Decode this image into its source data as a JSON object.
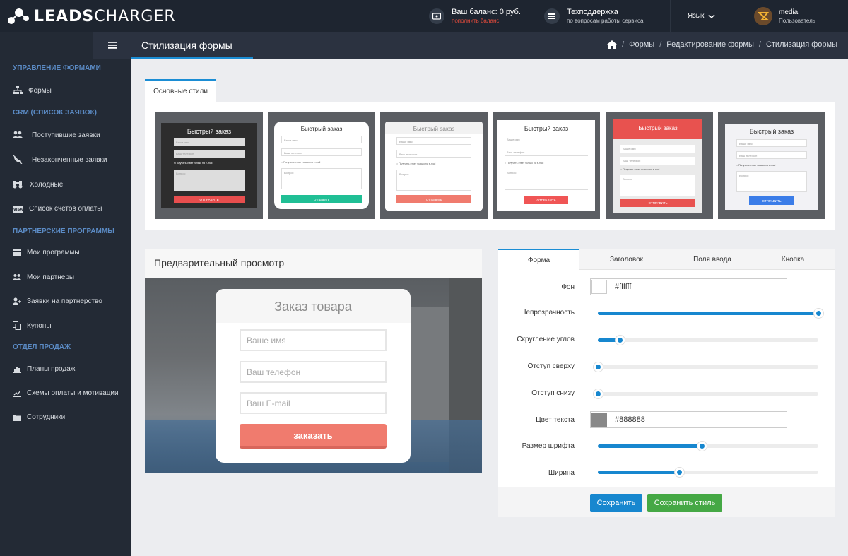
{
  "topbar": {
    "logo_bold": "LEADS",
    "logo_rest": "CHARGER",
    "balance": {
      "line1": "Ваш баланс: 0 руб.",
      "line2": "пополнить баланс"
    },
    "support": {
      "line1": "Техподдержка",
      "line2": "по вопросам работы сервиса"
    },
    "language": "Язык",
    "user": {
      "name": "media",
      "role": "Пользователь"
    }
  },
  "sidebar": {
    "sections": [
      {
        "title": "УПРАВЛЕНИЕ ФОРМАМИ",
        "items": [
          {
            "label": "Формы",
            "icon": "sitemap-icon"
          }
        ]
      },
      {
        "title": "CRM (СПИСОК ЗАЯВОК)",
        "items": [
          {
            "label": "Поступившие заявки",
            "icon": "users-icon"
          },
          {
            "label": "Незаконченные заявки",
            "icon": "phone-slash-icon"
          },
          {
            "label": "Холодные",
            "icon": "binoculars-icon"
          },
          {
            "label": "Список счетов оплаты",
            "icon": "visa-card-icon"
          }
        ]
      },
      {
        "title": "ПАРТНЕРСКИЕ ПРОГРАММЫ",
        "items": [
          {
            "label": "Мои программы",
            "icon": "list-icon"
          },
          {
            "label": "Мои партнеры",
            "icon": "users-icon"
          },
          {
            "label": "Заявки на партнерство",
            "icon": "user-plus-icon"
          },
          {
            "label": "Купоны",
            "icon": "copy-icon"
          }
        ]
      },
      {
        "title": "ОТДЕЛ ПРОДАЖ",
        "items": [
          {
            "label": "Планы продаж",
            "icon": "bar-chart-icon"
          },
          {
            "label": "Схемы оплаты и мотивации",
            "icon": "line-chart-icon"
          },
          {
            "label": "Сотрудники",
            "icon": "folder-icon"
          }
        ]
      }
    ]
  },
  "header": {
    "title": "Стилизация формы",
    "breadcrumb": [
      "Формы",
      "Редактирование формы",
      "Стилизация формы"
    ]
  },
  "styles": {
    "tab": "Основные стили",
    "tiles": [
      {
        "title": "Быстрый заказ",
        "name": "Ваше имя",
        "phone": "Ваш телефон",
        "check": "Получить ответ только на e-mail",
        "question": "Вопрос",
        "button": "ОТПРАВИТЬ"
      },
      {
        "title": "Быстрый заказ",
        "name": "Ваше имя",
        "phone": "Ваш телефон",
        "check": "Получить ответ только на e-mail",
        "question": "Вопрос",
        "button": "Отправить"
      },
      {
        "title": "Быстрый заказ",
        "name": "Ваше имя",
        "phone": "Ваш телефон",
        "check": "Получить ответ только на e-mail",
        "question": "Вопрос",
        "button": "Отправить"
      },
      {
        "title": "Быстрый заказ",
        "name": "Ваше имя",
        "phone": "Ваш телефон",
        "check": "Получить ответ только на e-mail",
        "question": "Вопрос",
        "button": "ОТПРАВИТЬ"
      },
      {
        "title": "Быстрый заказ",
        "name": "Ваше имя",
        "phone": "Ваш телефон",
        "check": "Получить ответ только на e-mail",
        "question": "Вопрос",
        "button": "ОТПРАВИТЬ"
      },
      {
        "title": "Быстрый заказ",
        "name": "Ваше имя",
        "phone": "Ваш телефон",
        "check": "Получить ответ только на e-mail",
        "question": "Вопрос",
        "button": "ОТПРАВИТЬ"
      }
    ]
  },
  "preview": {
    "heading": "Предварительный просмотр",
    "form_title": "Заказ товара",
    "name_placeholder": "Ваше имя",
    "phone_placeholder": "Ваш телефон",
    "email_placeholder": "Ваш E-mail",
    "button": "заказать"
  },
  "settings": {
    "tabs": [
      "Форма",
      "Заголовок",
      "Поля ввода",
      "Кнопка"
    ],
    "fields": {
      "bg_label": "Фон",
      "bg_value": "#ffffff",
      "opacity_label": "Непрозрачность",
      "opacity": 1.0,
      "radius_label": "Скругление углов",
      "radius": 0.1,
      "padding_top_label": "Отступ сверху",
      "padding_top": 0.0,
      "padding_bottom_label": "Отступ снизу",
      "padding_bottom": 0.0,
      "text_color_label": "Цвет текста",
      "text_color_value": "#888888",
      "font_size_label": "Размер шрифта",
      "font_size": 0.47,
      "width_label": "Ширина",
      "width": 0.37
    },
    "save": "Сохранить",
    "save_style": "Сохранить стиль"
  },
  "colors": {
    "accent": "#1787cf",
    "green": "#45a845",
    "red": "#e74c3c",
    "preview_button": "#f07b6e"
  }
}
